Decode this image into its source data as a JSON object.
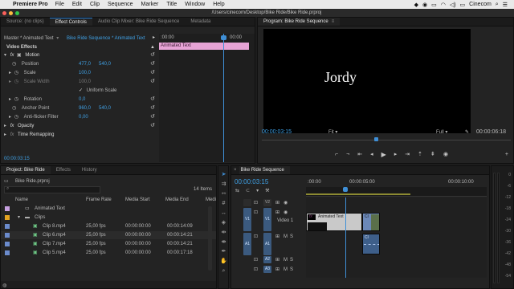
{
  "menubar": {
    "app": "Premiere Pro",
    "items": [
      "File",
      "Edit",
      "Clip",
      "Sequence",
      "Marker",
      "Title",
      "Window",
      "Help"
    ],
    "right_label": "Cinecom"
  },
  "window": {
    "path": "/Users/cinecom/Desktop/Bike Ride/Bike Ride.prproj"
  },
  "source_panel": {
    "tabs": [
      "Source: (no clips)",
      "Effect Controls",
      "Audio Clip Mixer: Bike Ride Sequence",
      "Metadata"
    ],
    "master": "Master * Animated Text",
    "sequence": "Bike Ride Sequence * Animated Text",
    "ruler_start": ":00:00",
    "ruler_mid": "00:00",
    "clip_bar": "Animated Text",
    "video_effects": "Video Effects",
    "motion": "Motion",
    "position_label": "Position",
    "position_x": "477,0",
    "position_y": "540,0",
    "scale_label": "Scale",
    "scale_value": "100,0",
    "scale_width_label": "Scale Width",
    "scale_width_value": "100,0",
    "uniform_scale": "Uniform Scale",
    "rotation_label": "Rotation",
    "rotation_value": "0,0",
    "anchor_label": "Anchor Point",
    "anchor_x": "960,0",
    "anchor_y": "540,0",
    "antiflicker_label": "Anti-flicker Filter",
    "antiflicker_value": "0,00",
    "opacity": "Opacity",
    "time_remap": "Time Remapping",
    "timecode": "00:00:03:15"
  },
  "program_panel": {
    "title": "Program: Bike Ride Sequence",
    "overlay_text": "Jordy",
    "timecode": "00:00:03:15",
    "fit": "Fit",
    "full": "Full",
    "duration": "00:00:06:18"
  },
  "project_panel": {
    "tabs": [
      "Project: Bike Ride",
      "Effects",
      "History"
    ],
    "file": "Bike Ride.prproj",
    "items_count": "14 Items",
    "columns": [
      "Name",
      "Frame Rate",
      "Media Start",
      "Media End",
      "Media"
    ],
    "rows": [
      {
        "name": "Animated Text",
        "fps": "",
        "start": "",
        "end": "",
        "type": "text",
        "color": "#c6a0e0"
      },
      {
        "name": "Clips",
        "fps": "",
        "start": "",
        "end": "",
        "type": "folder",
        "color": "#e3a321"
      },
      {
        "name": "Clip 8.mp4",
        "fps": "25,00 fps",
        "start": "00:00:00:00",
        "end": "00:00:14:09",
        "type": "clip",
        "color": "#6b8bcc"
      },
      {
        "name": "Clip 6.mp4",
        "fps": "25,00 fps",
        "start": "00:00:00:00",
        "end": "00:00:14:21",
        "type": "clip",
        "color": "#6b8bcc"
      },
      {
        "name": "Clip 7.mp4",
        "fps": "25,00 fps",
        "start": "00:00:00:00",
        "end": "00:00:14:21",
        "type": "clip",
        "color": "#6b8bcc"
      },
      {
        "name": "Clip 5.mp4",
        "fps": "25,00 fps",
        "start": "00:00:00:00",
        "end": "00:00:17:18",
        "type": "clip",
        "color": "#6b8bcc"
      }
    ]
  },
  "timeline": {
    "title": "Bike Ride Sequence",
    "timecode": "00:00:03:15",
    "ruler_start": ":00:00",
    "ruler_mid": "00:00:05:00",
    "ruler_end": "00:00:10:00",
    "tracks": [
      "V2",
      "V1",
      "A1",
      "A2",
      "A3"
    ],
    "v1_name": "Video 1",
    "text_clip": "Animated Text",
    "clip_b": "Cl",
    "fx": "fx",
    "m": "M",
    "s": "S"
  },
  "vu": {
    "labels": [
      "0",
      "-6",
      "-12",
      "-18",
      "-24",
      "-30",
      "-36",
      "-42",
      "-48",
      "-54"
    ]
  }
}
